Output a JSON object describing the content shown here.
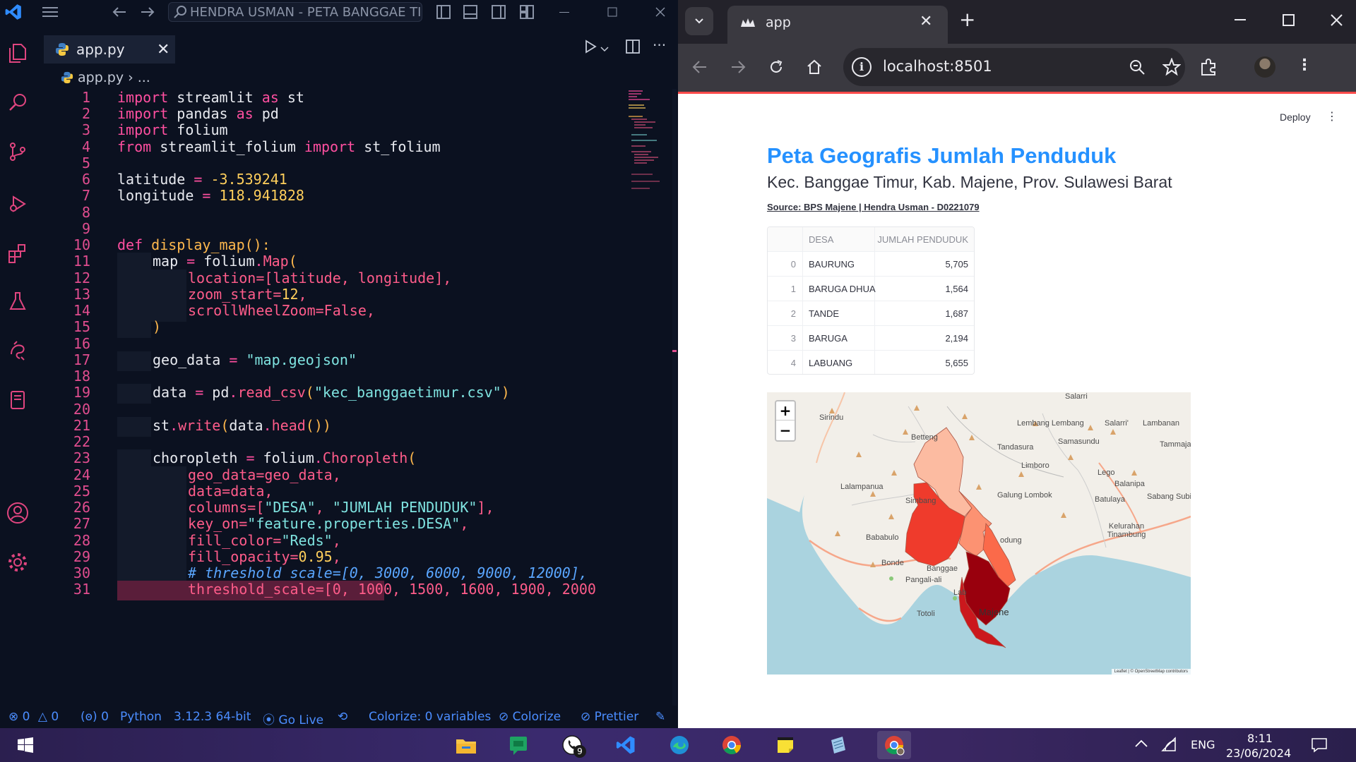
{
  "vscode": {
    "search_text": "HENDRA USMAN - PETA BANGGAE TIMUR",
    "tab_label": "app.py",
    "breadcrumb_file": "app.py",
    "breadcrumb_more": "...",
    "code_lines": [
      {
        "n": "1"
      },
      {
        "n": "2"
      },
      {
        "n": "3"
      },
      {
        "n": "4"
      },
      {
        "n": "5"
      },
      {
        "n": "6"
      },
      {
        "n": "7"
      },
      {
        "n": "8"
      },
      {
        "n": "9"
      },
      {
        "n": "10"
      },
      {
        "n": "11"
      },
      {
        "n": "12"
      },
      {
        "n": "13"
      },
      {
        "n": "14"
      },
      {
        "n": "15"
      },
      {
        "n": "16"
      },
      {
        "n": "17"
      },
      {
        "n": "18"
      },
      {
        "n": "19"
      },
      {
        "n": "20"
      },
      {
        "n": "21"
      },
      {
        "n": "22"
      },
      {
        "n": "23"
      },
      {
        "n": "24"
      },
      {
        "n": "25"
      },
      {
        "n": "26"
      },
      {
        "n": "27"
      },
      {
        "n": "28"
      },
      {
        "n": "29"
      },
      {
        "n": "30"
      },
      {
        "n": "31"
      }
    ],
    "code": {
      "l1": [
        "import",
        " streamlit ",
        "as",
        " st"
      ],
      "l2": [
        "import",
        " pandas ",
        "as",
        " pd"
      ],
      "l3": [
        "import",
        " folium"
      ],
      "l4": [
        "from",
        " streamlit_folium ",
        "import",
        " st_folium"
      ],
      "l6": [
        "latitude ",
        "=",
        " -3.539241"
      ],
      "l7": [
        "longitude ",
        "=",
        " 118.941828"
      ],
      "l10": [
        "def",
        " display_map",
        "():"
      ],
      "l11": [
        "map ",
        "=",
        " folium",
        ".",
        "Map",
        "("
      ],
      "l12": [
        "location=[latitude, longitude],"
      ],
      "l13": [
        "zoom_start=",
        "12",
        ","
      ],
      "l14": [
        "scrollWheelZoom=False,"
      ],
      "l15": [
        ")"
      ],
      "l17": [
        "geo_data ",
        "=",
        " ",
        "\"map.geojson\""
      ],
      "l19": [
        "data ",
        "=",
        " pd",
        ".",
        "read_csv",
        "(",
        "\"kec_banggaetimur.csv\"",
        ")"
      ],
      "l21": [
        "st",
        ".",
        "write",
        "(",
        "data",
        ".",
        "head",
        "())"
      ],
      "l23": [
        "choropleth ",
        "=",
        " folium",
        ".",
        "Choropleth",
        "("
      ],
      "l24": [
        "geo_data=geo_data,"
      ],
      "l25": [
        "data=data,"
      ],
      "l26": [
        "columns=[",
        "\"DESA\"",
        ", ",
        "\"JUMLAH PENDUDUK\"",
        "],"
      ],
      "l27": [
        "key_on=",
        "\"feature.properties.DESA\"",
        ","
      ],
      "l28": [
        "fill_color=",
        "\"Reds\"",
        ","
      ],
      "l29": [
        "fill_opacity=",
        "0.95",
        ","
      ],
      "l30": [
        "# threshold_scale=[0, 3000, 6000, 9000, 12000],"
      ],
      "l31": [
        "threshold_scale=[0, 1000, 1500, 1600, 1900, 2000"
      ]
    },
    "status": {
      "errors": "0",
      "warnings": "0",
      "ports": "0",
      "language": "Python",
      "interpreter": "3.12.3 64-bit",
      "go_live": "Go Live",
      "colorize_vars": "Colorize: 0 variables",
      "colorize": "Colorize",
      "prettier": "Prettier"
    },
    "colors": {
      "bg": "#0b1120",
      "keyword": "#ff4fa0",
      "string": "#7fe3e0",
      "number": "#ffcf5c",
      "status_fg": "#4b8dff"
    }
  },
  "chrome": {
    "tab_title": "app",
    "url": "localhost:8501",
    "accent": "#ff4b4b"
  },
  "streamlit": {
    "deploy": "Deploy",
    "menu": "⋮",
    "title": "Peta Geografis Jumlah Penduduk",
    "subtitle": "Kec. Banggae Timur, Kab. Majene, Prov. Sulawesi Barat",
    "source": "Source: BPS Majene | Hendra Usman - D0221079",
    "table": {
      "columns": [
        "",
        "DESA",
        "JUMLAH PENDUDUK"
      ],
      "rows": [
        {
          "idx": "0",
          "desa": "BAURUNG",
          "jumlah": "5,705"
        },
        {
          "idx": "1",
          "desa": "BARUGA DHUA",
          "jumlah": "1,564"
        },
        {
          "idx": "2",
          "desa": "TANDE",
          "jumlah": "1,687"
        },
        {
          "idx": "3",
          "desa": "BARUGA",
          "jumlah": "2,194"
        },
        {
          "idx": "4",
          "desa": "LABUANG",
          "jumlah": "5,655"
        }
      ]
    },
    "map": {
      "zoom_in": "+",
      "zoom_out": "−",
      "attribution": "Leaflet | © OpenStreetMap contributors",
      "place_labels": [
        "Salarri",
        "Sirindu",
        "Betteng",
        "Lembang Lembang",
        "Salarri'",
        "Lambanan",
        "Samasundu",
        "Tammaja",
        "Tandasura",
        "Limboro",
        "Lego",
        "Balanipa",
        "Lalampanua",
        "Simbang",
        "Galung Lombok",
        "Batulaya",
        "Sabang Subik",
        "Kelurahan Tinambung",
        "Bababulo",
        "Bonde",
        "odung",
        "Banggae",
        "Pangali-ali",
        "Lab",
        "Totoli",
        "Majene"
      ],
      "choropleth_colors": [
        "#fcbba1",
        "#fc9272",
        "#fb6a4a",
        "#ef3b2c",
        "#cb181d",
        "#99000d"
      ]
    }
  },
  "taskbar": {
    "lang": "ENG",
    "time": "8:11",
    "date": "23/06/2024",
    "whatsapp_badge": "9"
  }
}
